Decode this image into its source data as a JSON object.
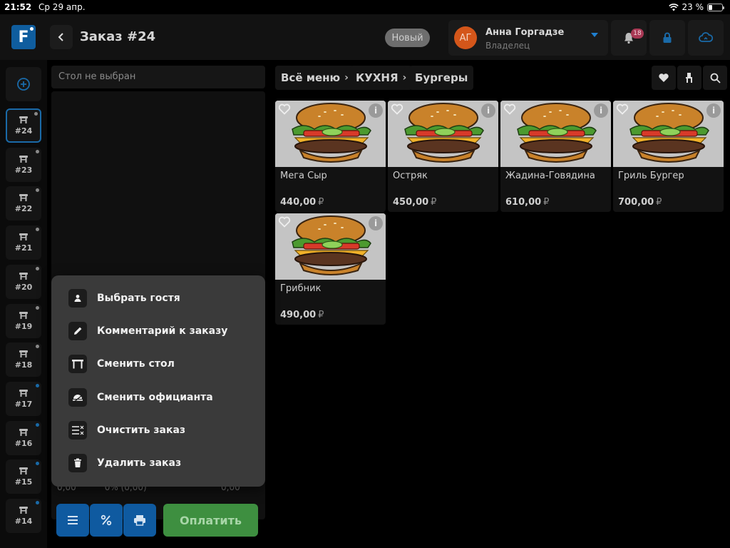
{
  "statusbar": {
    "time": "21:52",
    "date": "Ср 29 апр.",
    "battery": "23 %"
  },
  "header": {
    "logo": "F",
    "title": "Заказ #24",
    "status_badge": "Новый",
    "user": {
      "initials": "АГ",
      "name": "Анна Горгадзе",
      "role": "Владелец"
    },
    "notifications_count": "18"
  },
  "orders": [
    {
      "label": "#24",
      "status_color": "#8a8a8a",
      "active": true
    },
    {
      "label": "#23",
      "status_color": "#8a8a8a"
    },
    {
      "label": "#22",
      "status_color": "#8a8a8a"
    },
    {
      "label": "#21",
      "status_color": "#8a8a8a"
    },
    {
      "label": "#20",
      "status_color": "#8a8a8a"
    },
    {
      "label": "#19",
      "status_color": "#8a8a8a"
    },
    {
      "label": "#18",
      "status_color": "#8a8a8a"
    },
    {
      "label": "#17",
      "status_color": "#1a6aa8"
    },
    {
      "label": "#16",
      "status_color": "#1a6aa8"
    },
    {
      "label": "#15",
      "status_color": "#1a6aa8"
    },
    {
      "label": "#14",
      "status_color": "#1a6aa8"
    }
  ],
  "order_panel": {
    "table_placeholder": "Стол не выбран",
    "total_left": "0,00",
    "total_discount": "0% (0,00)",
    "total_right": "0,00",
    "pay_label": "Оплатить"
  },
  "context_menu": [
    {
      "label": "Выбрать гостя",
      "icon": "person-icon"
    },
    {
      "label": "Комментарий к заказу",
      "icon": "pencil-icon"
    },
    {
      "label": "Сменить стол",
      "icon": "table-icon"
    },
    {
      "label": "Сменить официанта",
      "icon": "waiter-icon"
    },
    {
      "label": "Очистить заказ",
      "icon": "clear-list-icon"
    },
    {
      "label": "Удалить заказ",
      "icon": "trash-icon"
    }
  ],
  "breadcrumb": [
    "Всё меню",
    "КУХНЯ",
    "Бургеры"
  ],
  "products": [
    {
      "name": "Мега Сыр",
      "price": "440,00",
      "currency": "₽"
    },
    {
      "name": "Остряк",
      "price": "450,00",
      "currency": "₽"
    },
    {
      "name": "Жадина-Говядина",
      "price": "610,00",
      "currency": "₽"
    },
    {
      "name": "Гриль Бургер",
      "price": "700,00",
      "currency": "₽"
    },
    {
      "name": "Грибник",
      "price": "490,00",
      "currency": "₽"
    }
  ],
  "colors": {
    "accent": "#1a6aa8",
    "pay": "#3e8f40",
    "avatar": "#d4561a",
    "badge": "#a83854"
  }
}
